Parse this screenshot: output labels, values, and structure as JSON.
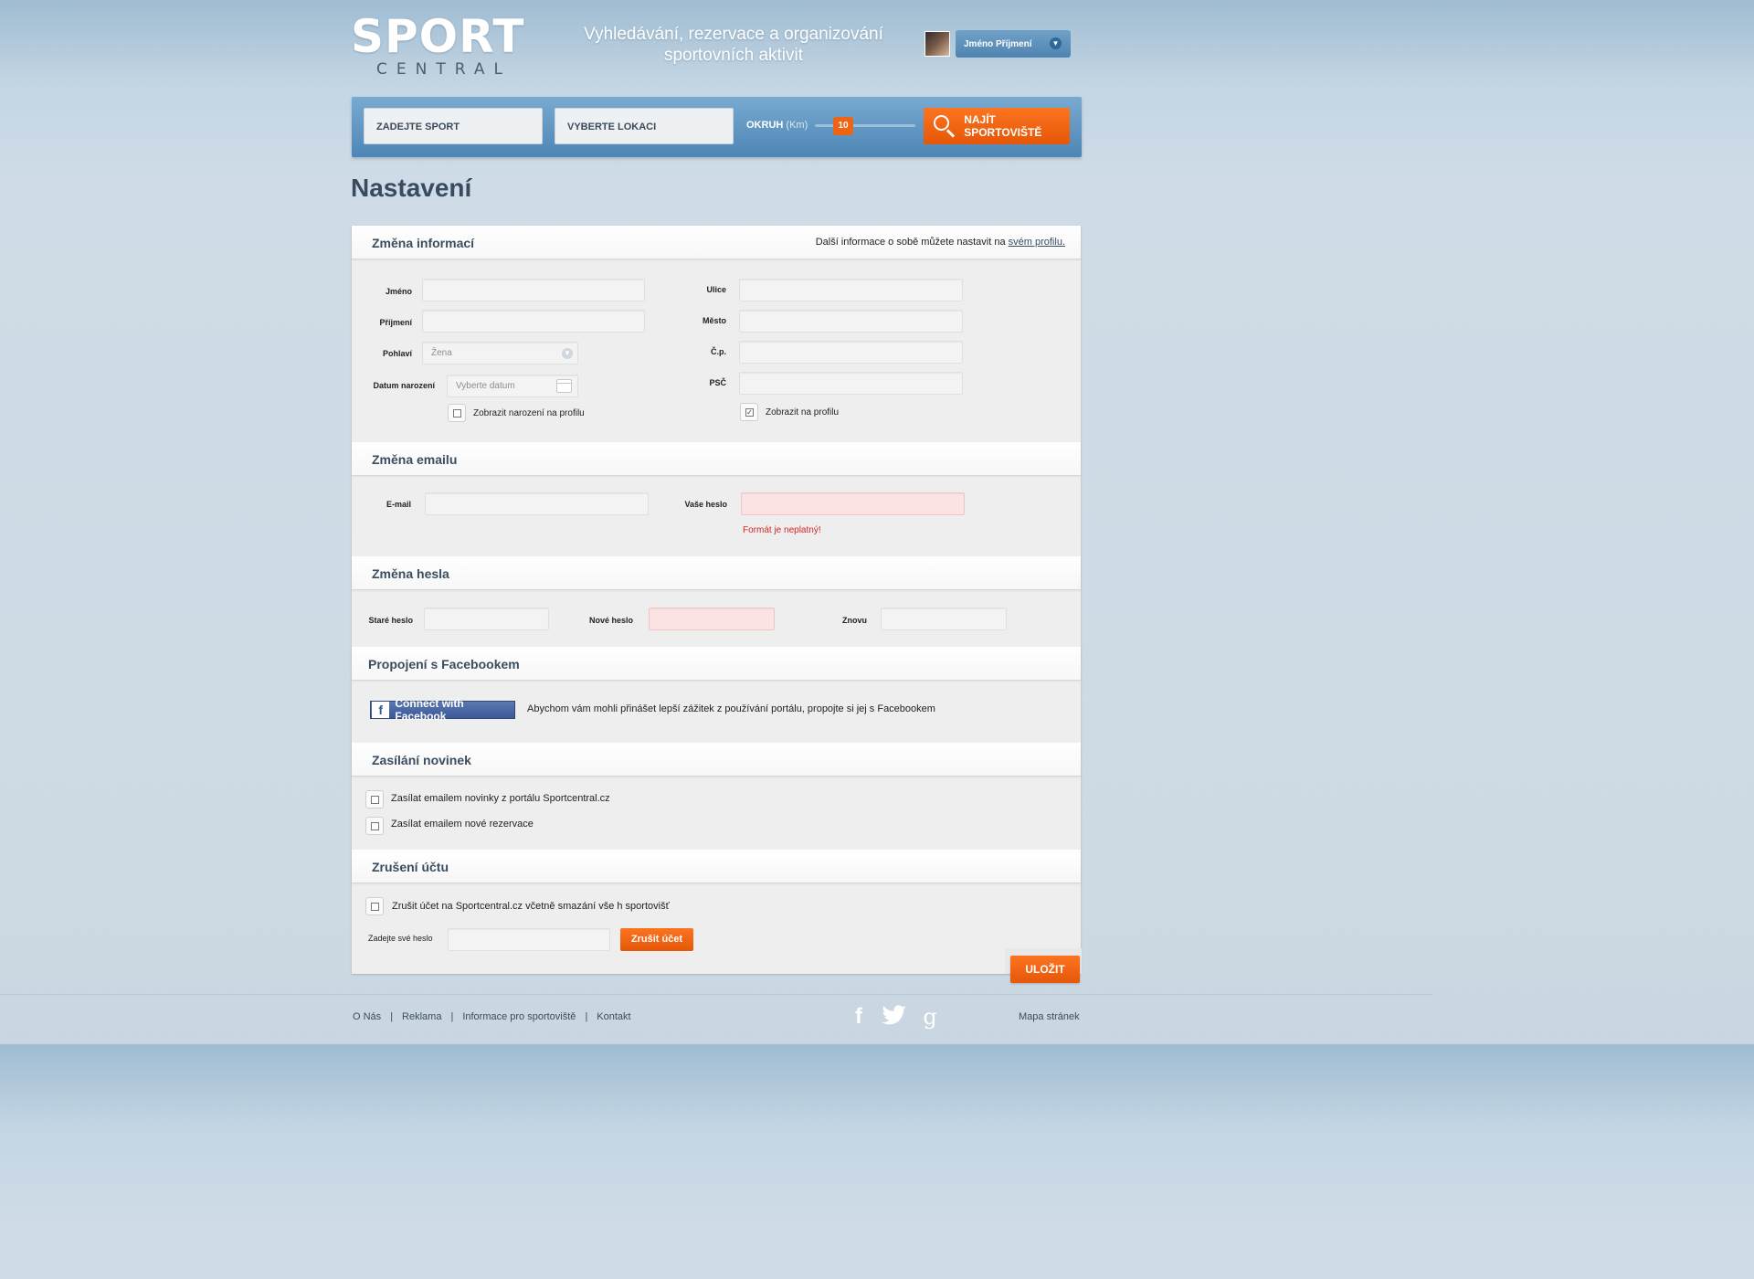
{
  "header": {
    "logo_main": "SPORT",
    "logo_sub": "CENTRAL",
    "tagline": "Vyhledávání, rezervace a organizování sportovních aktivit",
    "user_name": "Jméno Příjmení"
  },
  "search": {
    "sport_placeholder": "ZADEJTE SPORT",
    "location_placeholder": "VYBERTE LOKACI",
    "radius_label": "OKRUH",
    "radius_unit": "(Km)",
    "radius_value": "10",
    "find_label": "NAJÍT SPORTOVIŠTĚ"
  },
  "page_title": "Nastavení",
  "info": {
    "title": "Změna informací",
    "note_text": "Další informace o sobě můžete nastavit na",
    "note_link": "svém profilu.",
    "first_name_label": "Jméno",
    "last_name_label": "Příjmení",
    "gender_label": "Pohlaví",
    "gender_value": "Žena",
    "birth_label": "Datum narození",
    "birth_placeholder": "Vyberte datum",
    "show_birth_label": "Zobrazit narození na profilu",
    "show_birth_checked": false,
    "street_label": "Ulice",
    "city_label": "Město",
    "house_no_label": "Č.p.",
    "zip_label": "PSČ",
    "show_profile_label": "Zobrazit na profilu",
    "show_profile_checked": true
  },
  "email": {
    "title": "Změna emailu",
    "email_label": "E-mail",
    "password_label": "Vaše heslo",
    "error": "Formát  je neplatný!"
  },
  "password": {
    "title": "Změna hesla",
    "old_label": "Staré heslo",
    "new_label": "Nové heslo",
    "again_label": "Znovu"
  },
  "facebook": {
    "title": "Propojení s Facebookem",
    "button_label": "Connect with Facebook",
    "text": "Abychom vám mohli přinášet lepší zážitek z používání portálu, propojte si jej s Facebookem"
  },
  "newsletter": {
    "title": "Zasílání novinek",
    "option_news": "Zasílat emailem novinky z portálu Sportcentral.cz",
    "option_reservations": "Zasílat emailem nové rezervace"
  },
  "cancel": {
    "title": "Zrušení účtu",
    "checkbox_label": "Zrušit účet na Sportcentral.cz včetně smazání vše h sportovišť",
    "password_label": "Zadejte své heslo",
    "button_label": "Zrušit účet"
  },
  "save_label": "ULOŽIT",
  "footer": {
    "links": [
      "O Nás",
      "Reklama",
      "Informace pro sportoviště",
      "Kontakt"
    ],
    "sitemap": "Mapa stránek"
  },
  "colors": {
    "accent": "#f0620f",
    "bar_blue": "#5a90bd",
    "error": "#d42626"
  }
}
